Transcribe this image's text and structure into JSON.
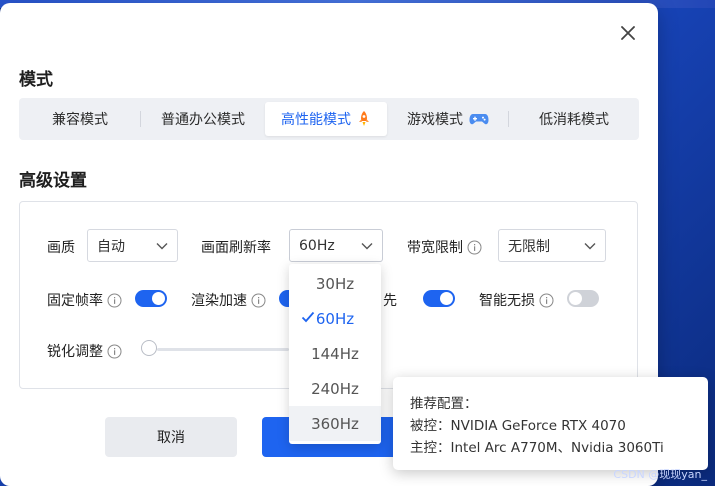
{
  "dialog": {
    "close_icon": "close-icon",
    "mode_title": "模式",
    "advanced_title": "高级设置"
  },
  "modes": [
    {
      "label": "兼容模式",
      "icon": null,
      "active": false
    },
    {
      "label": "普通办公模式",
      "icon": null,
      "active": false
    },
    {
      "label": "高性能模式",
      "icon": "rocket-icon",
      "active": true
    },
    {
      "label": "游戏模式",
      "icon": "gamepad-icon",
      "active": false
    },
    {
      "label": "低消耗模式",
      "icon": null,
      "active": false
    }
  ],
  "settings": {
    "quality": {
      "label": "画质",
      "value": "自动"
    },
    "refresh": {
      "label": "画面刷新率",
      "value": "60Hz"
    },
    "bandwidth": {
      "label": "带宽限制",
      "value": "无限制"
    },
    "fixed_fps": {
      "label": "固定帧率",
      "on": true
    },
    "render_accel": {
      "label": "渲染加速",
      "on": true
    },
    "priority": {
      "label_partial": "先",
      "on": true
    },
    "smart_lossless": {
      "label": "智能无损",
      "on": false
    },
    "sharpen": {
      "label": "锐化调整",
      "level": 0
    }
  },
  "refresh_options": [
    {
      "label": "30Hz",
      "selected": false
    },
    {
      "label": "60Hz",
      "selected": true
    },
    {
      "label": "144Hz",
      "selected": false
    },
    {
      "label": "240Hz",
      "selected": false
    },
    {
      "label": "360Hz",
      "selected": false,
      "hover": true
    }
  ],
  "footer": {
    "cancel_label": "取消"
  },
  "tooltip": {
    "title": "推荐配置：",
    "controlled": "被控：NVIDIA GeForce RTX 4070",
    "controller": "主控：Intel Arc A770M、Nvidia 3060Ti"
  },
  "watermark": "CSDN @现现yan_",
  "colors": {
    "accent": "#1e64f0",
    "toggle_off": "#cfd2d8",
    "background": "#1a49c4"
  }
}
